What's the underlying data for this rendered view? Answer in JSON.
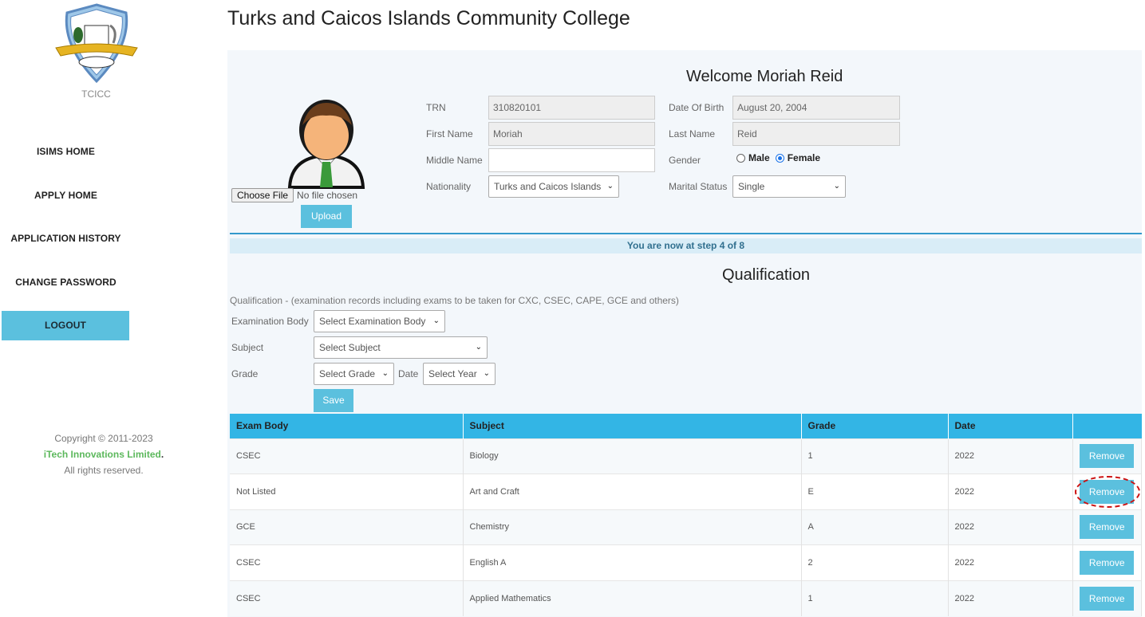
{
  "college": {
    "title": "Turks and Caicos Islands Community College",
    "abbr": "TCICC"
  },
  "sidebar": {
    "items": [
      {
        "label": "ISIMS HOME"
      },
      {
        "label": "APPLY HOME"
      },
      {
        "label": "APPLICATION HISTORY"
      },
      {
        "label": "CHANGE PASSWORD"
      },
      {
        "label": "LOGOUT"
      }
    ]
  },
  "footer": {
    "copyright": "Copyright © 2011-2023",
    "company": "iTech Innovations Limited",
    "dot": ".",
    "rights": "All rights reserved."
  },
  "profile": {
    "welcome": "Welcome Moriah Reid",
    "choose_file": "Choose File",
    "no_file": "No file chosen",
    "upload": "Upload",
    "trn_label": "TRN",
    "trn": "310820101",
    "dob_label": "Date Of Birth",
    "dob": "August 20, 2004",
    "first_label": "First Name",
    "first": "Moriah",
    "last_label": "Last Name",
    "last": "Reid",
    "middle_label": "Middle Name",
    "middle": "",
    "gender_label": "Gender",
    "male": "Male",
    "female": "Female",
    "nationality_label": "Nationality",
    "nationality": "Turks and Caicos Islands",
    "marital_label": "Marital Status",
    "marital": "Single"
  },
  "step": "You are now at step 4 of 8",
  "qualification": {
    "title": "Qualification",
    "note": "Qualification - (examination records including exams to be taken for CXC, CSEC, CAPE, GCE and others)",
    "exam_body_label": "Examination Body",
    "exam_body_placeholder": "Select Examination Body",
    "subject_label": "Subject",
    "subject_placeholder": "Select Subject",
    "grade_label": "Grade",
    "grade_placeholder": "Select Grade",
    "date_label": "Date",
    "date_placeholder": "Select Year",
    "save": "Save"
  },
  "table": {
    "headers": [
      "Exam Body",
      "Subject",
      "Grade",
      "Date",
      ""
    ],
    "remove_label": "Remove",
    "rows": [
      {
        "body": "CSEC",
        "subject": "Biology",
        "grade": "1",
        "date": "2022"
      },
      {
        "body": "Not Listed",
        "subject": "Art and Craft",
        "grade": "E",
        "date": "2022"
      },
      {
        "body": "GCE",
        "subject": "Chemistry",
        "grade": "A",
        "date": "2022"
      },
      {
        "body": "CSEC",
        "subject": "English A",
        "grade": "2",
        "date": "2022"
      },
      {
        "body": "CSEC",
        "subject": "Applied Mathematics",
        "grade": "1",
        "date": "2022"
      }
    ]
  }
}
